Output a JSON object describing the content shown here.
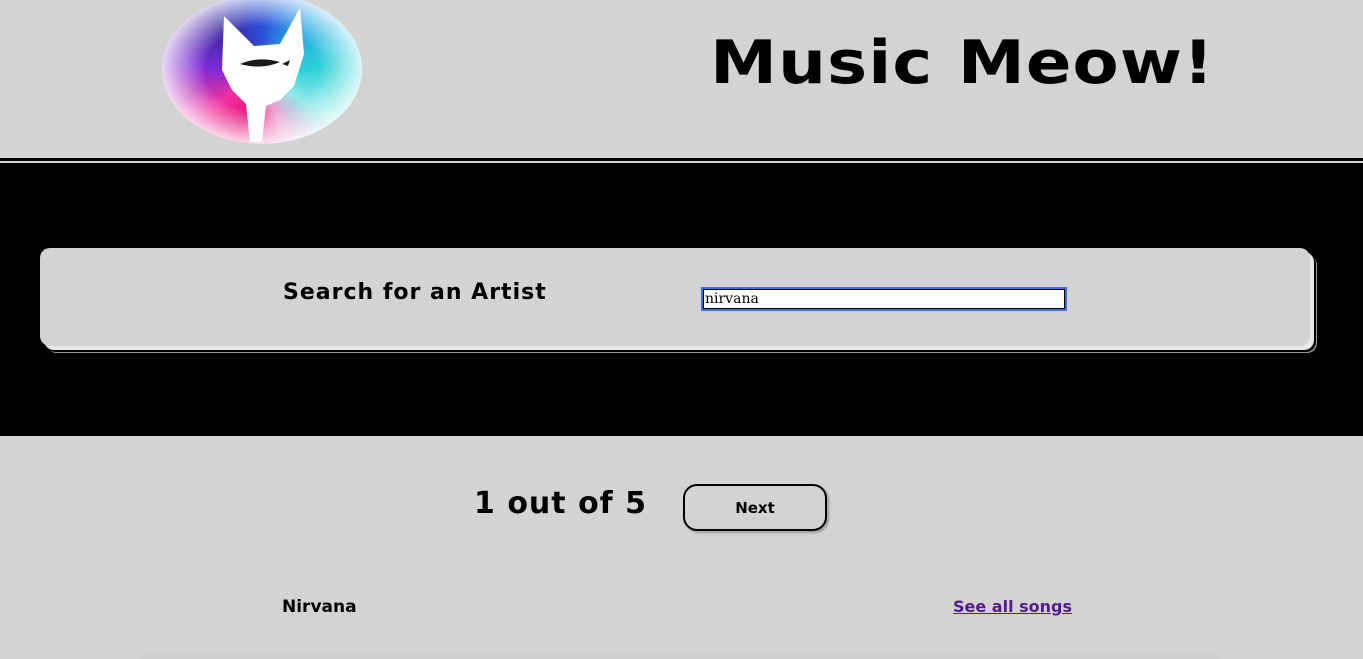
{
  "header": {
    "title": "Music Meow!",
    "logo_icon": "cat-logo-icon",
    "colors": {
      "background": "#d3d3d3",
      "logo_palette": [
        "#e6197a",
        "#7b2bd6",
        "#2b4fd8",
        "#29d0d6"
      ]
    }
  },
  "search": {
    "label": "Search for an Artist",
    "value": "nirvana",
    "colors": {
      "band": "#000000",
      "input_focus": "#3f6fe0"
    }
  },
  "results": {
    "pager_text": "1 out of 5",
    "next_label": "Next",
    "items": [
      {
        "artist": "Nirvana",
        "link_label": "See all songs"
      }
    ],
    "colors": {
      "link": "#551a8b"
    }
  }
}
